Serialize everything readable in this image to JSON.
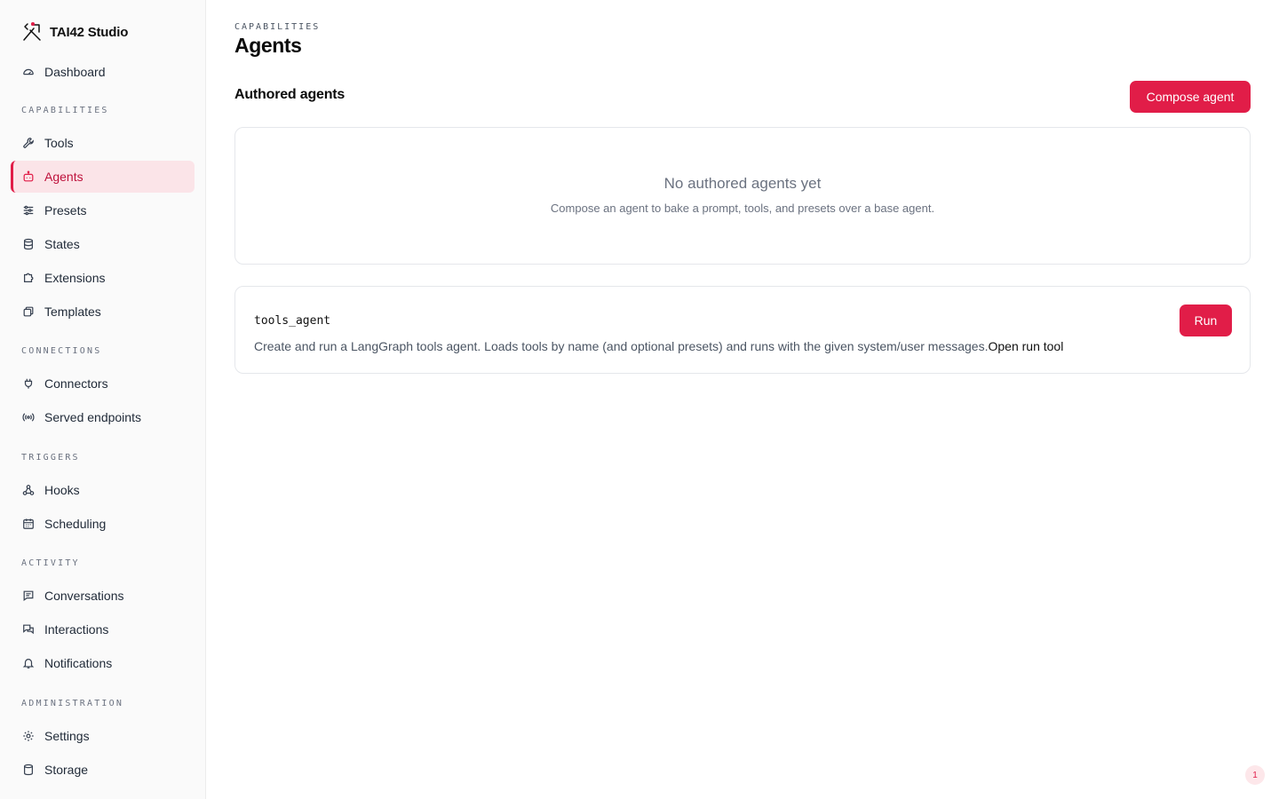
{
  "brand": {
    "name": "TAI42 Studio",
    "logo_icon": "tools-cross-icon"
  },
  "nav": {
    "dashboard": "Dashboard",
    "sections": {
      "capabilities": "CAPABILITIES",
      "connections": "CONNECTIONS",
      "triggers": "TRIGGERS",
      "activity": "ACTIVITY",
      "administration": "ADMINISTRATION"
    },
    "items": {
      "tools": "Tools",
      "agents": "Agents",
      "presets": "Presets",
      "states": "States",
      "extensions": "Extensions",
      "templates": "Templates",
      "connectors": "Connectors",
      "served_endpoints": "Served endpoints",
      "hooks": "Hooks",
      "scheduling": "Scheduling",
      "conversations": "Conversations",
      "interactions": "Interactions",
      "notifications": "Notifications",
      "settings": "Settings",
      "storage": "Storage"
    },
    "active": "agents"
  },
  "page": {
    "eyebrow": "CAPABILITIES",
    "title": "Agents",
    "section_title": "Authored agents",
    "compose_label": "Compose agent"
  },
  "empty_state": {
    "title": "No authored agents yet",
    "subtitle": "Compose an agent to bake a prompt, tools, and presets over a base agent."
  },
  "agents": [
    {
      "name": "tools_agent",
      "description": "Create and run a LangGraph tools agent. Loads tools by name (and optional presets) and runs with the given system/user messages.",
      "link_label": "Open run tool",
      "run_label": "Run"
    }
  ],
  "badge": {
    "count": "1"
  },
  "colors": {
    "accent": "#e11d48",
    "accent_bg": "#fbe4e8"
  }
}
